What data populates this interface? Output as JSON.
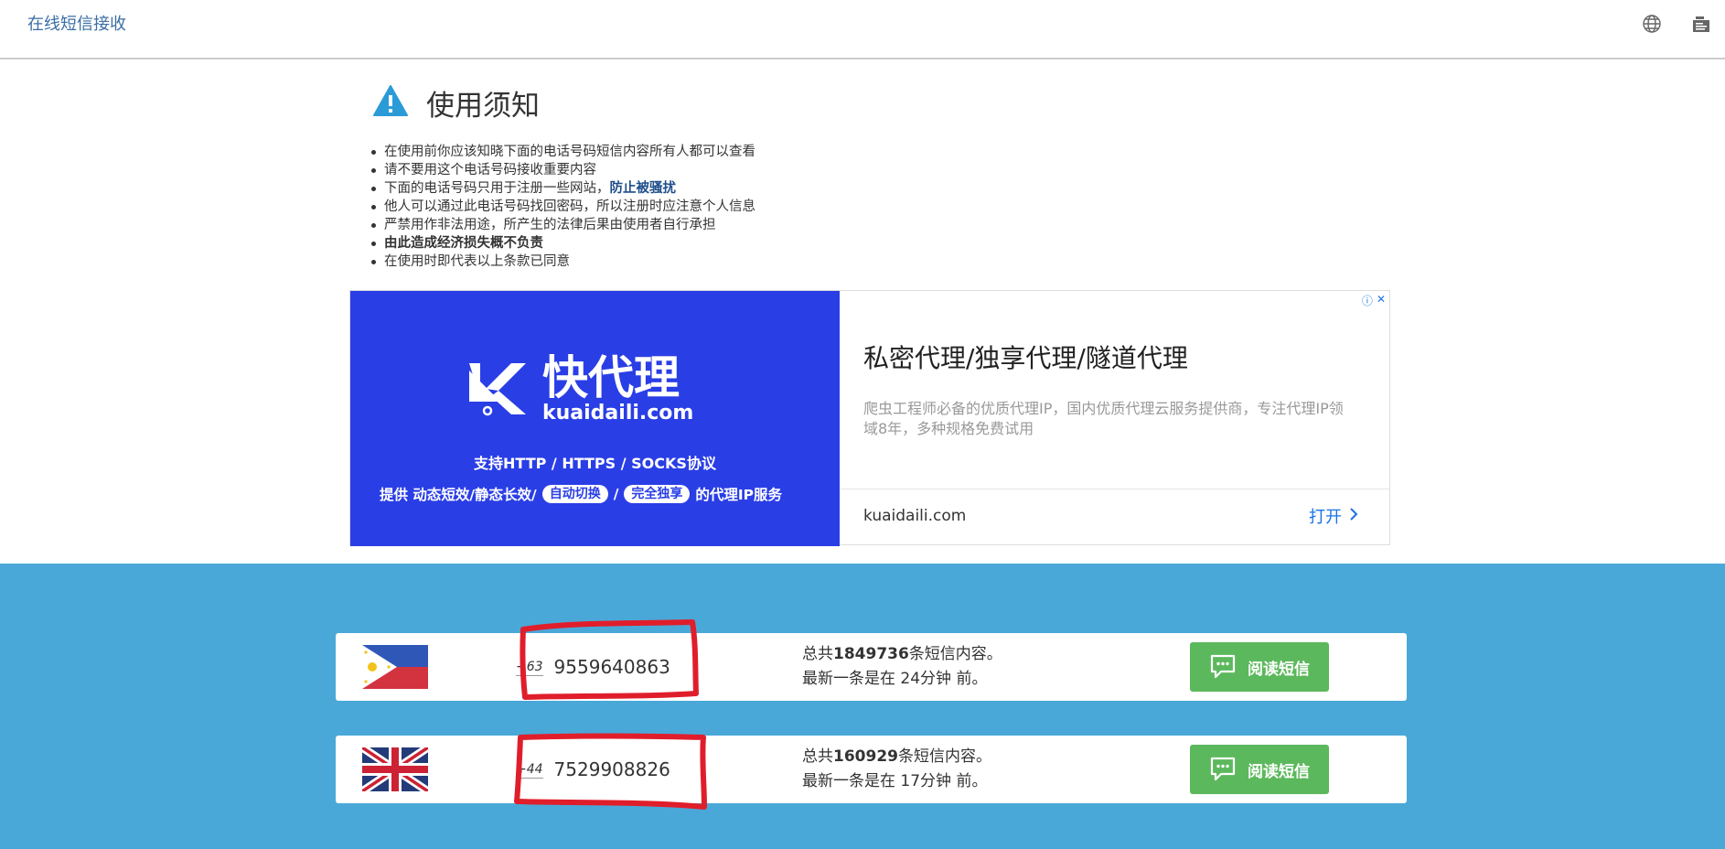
{
  "header": {
    "brand": "在线短信接收",
    "icons": [
      "globe-icon",
      "menu-icon"
    ]
  },
  "notice": {
    "title": "使用须知",
    "items": [
      "在使用前你应该知晓下面的电话号码短信内容所有人都可以查看",
      "请不要用这个电话号码接收重要内容",
      "下面的电话号码只用于注册一些网站，",
      "他人可以通过此电话号码找回密码，所以注册时应注意个人信息",
      "严禁用作非法用途，所产生的法律后果由使用者自行承担",
      "由此造成经济损失概不负责",
      "在使用时即代表以上条款已同意"
    ],
    "item3_highlight": "防止被骚扰"
  },
  "ad": {
    "logo_cn": "快代理",
    "logo_en": "kuaidaili.com",
    "support": "支持HTTP / HTTPS / SOCKS协议",
    "provide_prefix": "提供 动态短效/静态长效/",
    "pill1": "自动切换",
    "separator": "/",
    "pill2": "完全独享",
    "provide_suffix": "的代理IP服务",
    "headline": "私密代理/独享代理/隧道代理",
    "description": "爬虫工程师必备的优质代理IP，国内优质代理云服务提供商，专注代理IP领域8年，多种规格免费试用",
    "domain": "kuaidaili.com",
    "open_label": "打开",
    "colors": {
      "left_bg": "#2a3ee6",
      "link": "#1a73e8"
    }
  },
  "numbers": [
    {
      "flag": "philippines-flag",
      "country_code": "+63",
      "phone": "9559640863",
      "total_prefix": "总共",
      "total_count": "1849736",
      "total_suffix": "条短信内容。",
      "latest": "最新一条是在 24分钟 前。",
      "button_label": "阅读短信"
    },
    {
      "flag": "uk-flag",
      "country_code": "+44",
      "phone": "7529908826",
      "total_prefix": "总共",
      "total_count": "160929",
      "total_suffix": "条短信内容。",
      "latest": "最新一条是在 17分钟 前。",
      "button_label": "阅读短信"
    }
  ],
  "colors": {
    "section_bg": "#4aa8d8",
    "button_green": "#5cb85c",
    "annotation_red": "#e01e2b"
  }
}
